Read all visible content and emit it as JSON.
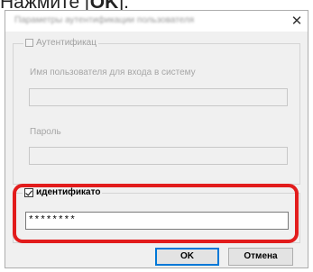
{
  "caption": {
    "prefix": "Нажмите [",
    "key": "OK",
    "suffix": "]."
  },
  "dialog": {
    "title": "Параметры аутентификации пользователя",
    "close_symbol": "✕",
    "auth_group": {
      "checkbox_label": "Аутентификац",
      "checked": false,
      "username_label": "Имя пользователя для входа в систему",
      "username_value": "",
      "password_label": "Пароль",
      "password_value": ""
    },
    "id_group": {
      "checkbox_label": "идентификато",
      "checked": true,
      "value": "********"
    },
    "buttons": {
      "ok_label": "OK",
      "cancel_label": "Отмена"
    }
  },
  "colors": {
    "highlight": "#e21c1c",
    "dialog_bg": "#f0f0f0"
  }
}
